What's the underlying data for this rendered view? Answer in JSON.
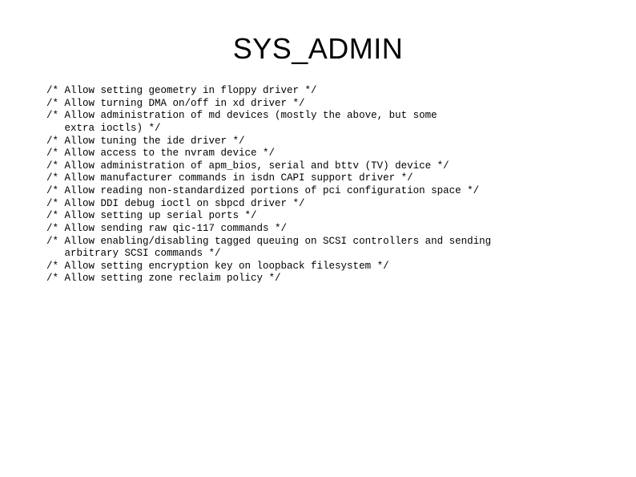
{
  "title": "SYS_ADMIN",
  "code": "/* Allow setting geometry in floppy driver */\n/* Allow turning DMA on/off in xd driver */\n/* Allow administration of md devices (mostly the above, but some\n   extra ioctls) */\n/* Allow tuning the ide driver */\n/* Allow access to the nvram device */\n/* Allow administration of apm_bios, serial and bttv (TV) device */\n/* Allow manufacturer commands in isdn CAPI support driver */\n/* Allow reading non-standardized portions of pci configuration space */\n/* Allow DDI debug ioctl on sbpcd driver */\n/* Allow setting up serial ports */\n/* Allow sending raw qic-117 commands */\n/* Allow enabling/disabling tagged queuing on SCSI controllers and sending\n   arbitrary SCSI commands */\n/* Allow setting encryption key on loopback filesystem */\n/* Allow setting zone reclaim policy */"
}
